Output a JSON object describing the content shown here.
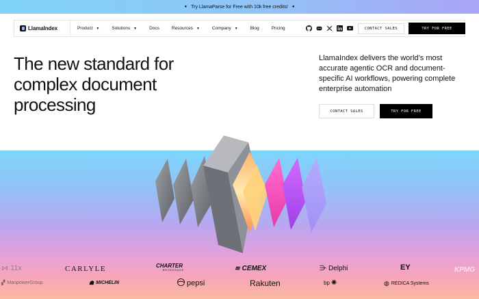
{
  "promo": {
    "text": "Try LlamaParse for Free with 10k free credits!"
  },
  "nav": {
    "logo_text": "LlamaIndex",
    "items": [
      {
        "label": "Product",
        "dropdown": true
      },
      {
        "label": "Solutions",
        "dropdown": true
      },
      {
        "label": "Docs",
        "dropdown": false
      },
      {
        "label": "Resources",
        "dropdown": true
      },
      {
        "label": "Company",
        "dropdown": true
      },
      {
        "label": "Blog",
        "dropdown": false
      },
      {
        "label": "Pricing",
        "dropdown": false
      }
    ],
    "social_icons": [
      "github-icon",
      "discord-icon",
      "x-icon",
      "linkedin-icon",
      "youtube-icon"
    ],
    "contact_label": "CONTACT SALES",
    "try_label": "TRY FOR FREE"
  },
  "hero": {
    "headline": "The new standard for complex document processing",
    "subtext": "LlamaIndex delivers the world’s most accurate agentic OCR and document-specific AI workflows, powering complete enterprise automation",
    "contact_label": "CONTACT SALES",
    "try_label": "TRY FOR FREE"
  },
  "logos": {
    "row1": [
      "11x",
      "CARLYLE",
      "CHARTER",
      "BROKERAGE",
      "CEMEX",
      "Delphi",
      "EY",
      "KPMG"
    ],
    "row2": [
      "ManpowerGroup",
      "MICHELIN",
      "pepsi",
      "Rakuten",
      "bp",
      "REDICA Systems"
    ]
  },
  "colors": {
    "accent_dark": "#000000",
    "promo_from": "#7fd3f7",
    "promo_to": "#a9a4f5"
  }
}
